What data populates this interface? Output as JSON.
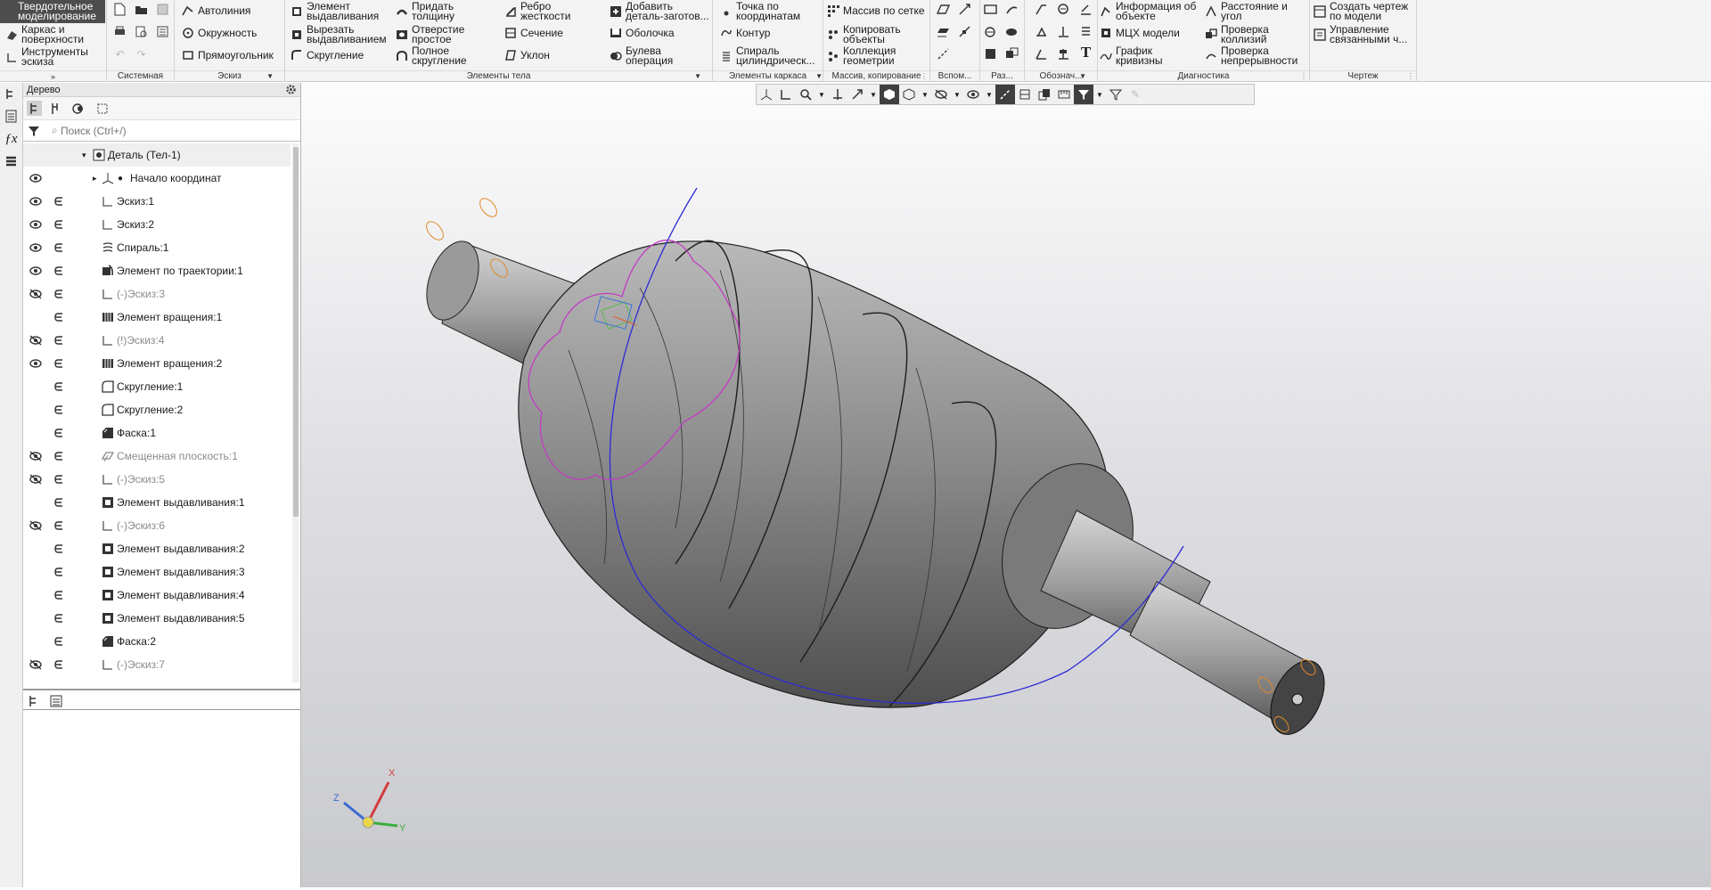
{
  "ribbon": {
    "modes": [
      {
        "label": "Твердотельное моделирование",
        "active": true
      },
      {
        "label": "Каркас и поверхности"
      },
      {
        "label": "Инструменты эскиза"
      }
    ],
    "groups": {
      "system": "Системная",
      "sketch": "Эскиз",
      "body": "Элементы тела",
      "wire": "Элементы каркаса",
      "array": "Массив, копирование",
      "aux": "Вспом...",
      "dim": "Раз...",
      "notes": "Обознач...",
      "diag": "Диагностика",
      "drawing": "Чертеж"
    },
    "sketch_tools": [
      "Автолиния",
      "Окружность",
      "Прямоугольник"
    ],
    "body_tools": [
      "Элемент выдавливания",
      "Вырезать выдавливанием",
      "Скругление",
      "Придать толщину",
      "Отверстие простое",
      "Полное скругление",
      "Ребро жесткости",
      "Сечение",
      "Уклон",
      "Добавить деталь-заготов...",
      "Оболочка",
      "Булева операция"
    ],
    "wire_tools": [
      "Точка по координатам",
      "Контур",
      "Спираль цилиндрическ..."
    ],
    "array_tools": [
      "Массив по сетке",
      "Копировать объекты",
      "Коллекция геометрии"
    ],
    "diag_tools": [
      "Информация об объекте",
      "МЦХ модели",
      "График кривизны",
      "Расстояние и угол",
      "Проверка коллизий",
      "Проверка непрерывности"
    ],
    "drawing_tools": [
      "Создать чертеж по модели",
      "Управление связанными ч..."
    ]
  },
  "tree": {
    "title": "Дерево",
    "search_placeholder": "Поиск (Ctrl+/)",
    "root": "Деталь (Тел-1)",
    "origin": "Начало координат",
    "items": [
      {
        "label": "Эскиз:1",
        "eye": "visible",
        "icon": "sketch-icon"
      },
      {
        "label": "Эскиз:2",
        "eye": "visible",
        "icon": "sketch-icon"
      },
      {
        "label": "Спираль:1",
        "eye": "visible",
        "icon": "spiral-icon"
      },
      {
        "label": "Элемент по траектории:1",
        "eye": "visible",
        "icon": "sweep-icon"
      },
      {
        "label": "(-)Эскиз:3",
        "eye": "hidden",
        "icon": "sketch-icon",
        "disabled": true
      },
      {
        "label": "Элемент вращения:1",
        "eye": "none",
        "icon": "revolve-icon"
      },
      {
        "label": "(!)Эскиз:4",
        "eye": "hidden",
        "icon": "sketch-icon",
        "disabled": true
      },
      {
        "label": "Элемент вращения:2",
        "eye": "visible",
        "icon": "revolve-icon"
      },
      {
        "label": "Скругление:1",
        "eye": "none",
        "icon": "fillet-icon"
      },
      {
        "label": "Скругление:2",
        "eye": "none",
        "icon": "fillet-icon"
      },
      {
        "label": "Фаска:1",
        "eye": "none",
        "icon": "chamfer-icon"
      },
      {
        "label": "Смещенная плоскость:1",
        "eye": "hidden",
        "icon": "plane-icon",
        "disabled": true
      },
      {
        "label": "(-)Эскиз:5",
        "eye": "hidden",
        "icon": "sketch-icon",
        "disabled": true
      },
      {
        "label": "Элемент выдавливания:1",
        "eye": "none",
        "icon": "extrude-icon"
      },
      {
        "label": "(-)Эскиз:6",
        "eye": "hidden",
        "icon": "sketch-icon",
        "disabled": true
      },
      {
        "label": "Элемент выдавливания:2",
        "eye": "none",
        "icon": "extrude-icon"
      },
      {
        "label": "Элемент выдавливания:3",
        "eye": "none",
        "icon": "extrude-icon"
      },
      {
        "label": "Элемент выдавливания:4",
        "eye": "none",
        "icon": "extrude-icon"
      },
      {
        "label": "Элемент выдавливания:5",
        "eye": "none",
        "icon": "extrude-icon"
      },
      {
        "label": "Фаска:2",
        "eye": "none",
        "icon": "chamfer-icon"
      },
      {
        "label": "(-)Эскиз:7",
        "eye": "hidden",
        "icon": "sketch-icon",
        "disabled": true
      }
    ]
  },
  "axes": {
    "x": "X",
    "y": "Y",
    "z": "Z"
  },
  "colors": {
    "ribbon_bg": "#f3f3f3",
    "mode_active": "#4d4d4d",
    "helix": "#2b2bd6",
    "profile": "#c23cc2",
    "hole_highlight": "#e08a2b",
    "model_gray": "#8a8a8a"
  }
}
